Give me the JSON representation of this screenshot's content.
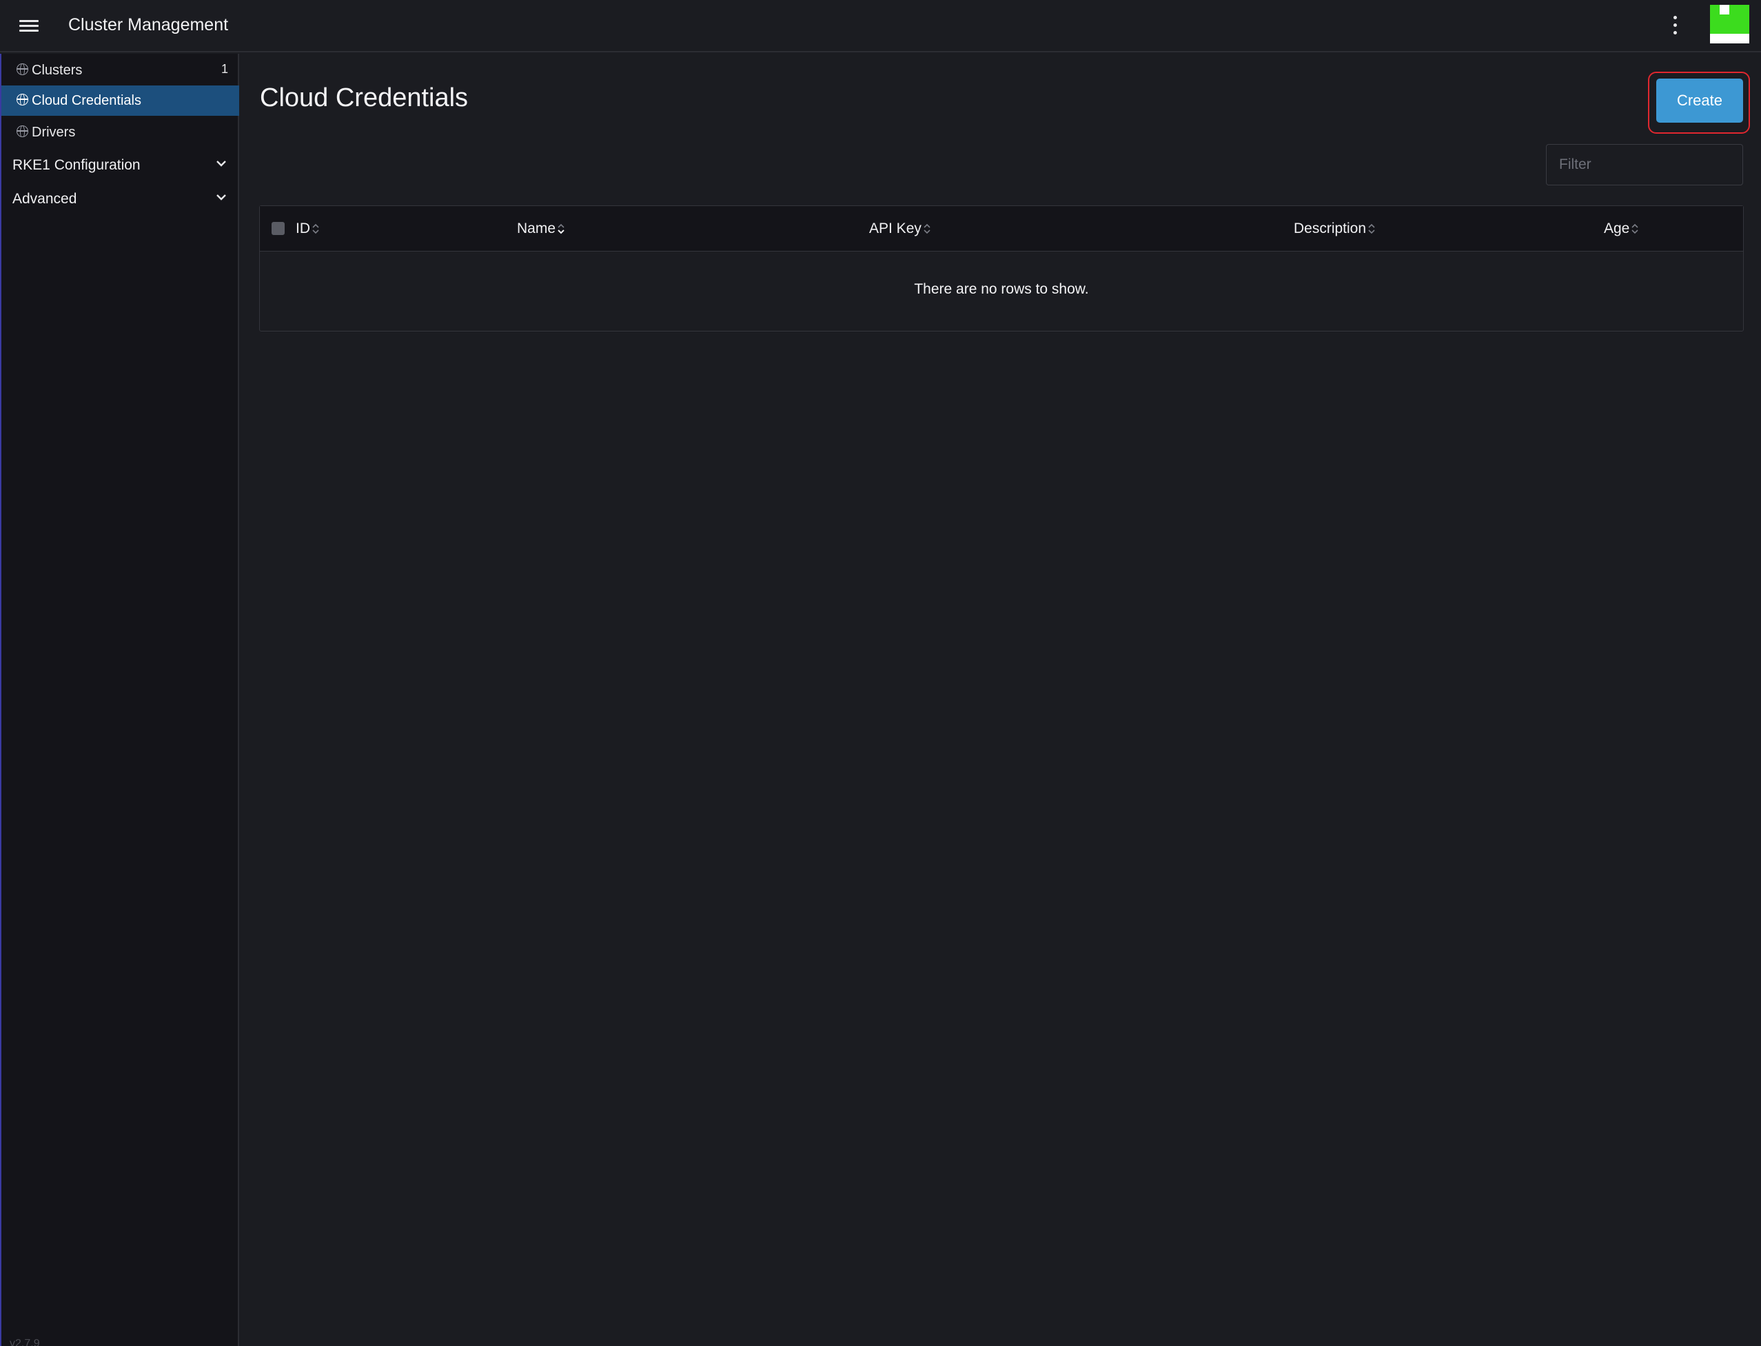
{
  "header": {
    "title": "Cluster Management",
    "menu_icon": "hamburger-menu-icon",
    "more_icon": "kebab-menu-icon",
    "avatar_colors": [
      "#3cdc1e",
      "#ffffff"
    ]
  },
  "sidebar": {
    "items": [
      {
        "label": "Clusters",
        "count": "1",
        "icon": "globe-icon",
        "active": false
      },
      {
        "label": "Cloud Credentials",
        "icon": "globe-icon",
        "active": true
      },
      {
        "label": "Drivers",
        "icon": "globe-icon",
        "active": false
      }
    ],
    "groups": [
      {
        "label": "RKE1 Configuration",
        "icon": "chevron-down-icon"
      },
      {
        "label": "Advanced",
        "icon": "chevron-down-icon"
      }
    ],
    "version": "v2.7.9"
  },
  "main": {
    "title": "Cloud Credentials",
    "create_label": "Create",
    "filter_placeholder": "Filter",
    "table": {
      "columns": [
        "ID",
        "Name",
        "API Key",
        "Description",
        "Age"
      ],
      "sorted_column": "Name",
      "empty_message": "There are no rows to show."
    }
  },
  "colors": {
    "accent": "#3d98d3",
    "active_nav": "#1c4f7d",
    "highlight_outline": "#e0272f",
    "background": "#1b1c21"
  }
}
